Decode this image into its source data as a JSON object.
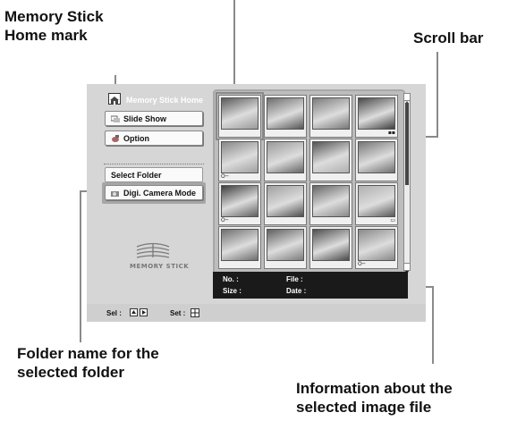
{
  "callouts": {
    "home_mark_line1": "Memory Stick",
    "home_mark_line2": "Home mark",
    "scroll_bar": "Scroll bar",
    "folder_name_line1": "Folder name for the",
    "folder_name_line2": "selected folder",
    "info_line1": "Information about the",
    "info_line2": "selected image file"
  },
  "sidebar": {
    "home_title": "Memory Stick Home",
    "slide_show": "Slide Show",
    "option": "Option",
    "select_folder": "Select Folder",
    "folder_name": "Digi. Camera Mode"
  },
  "logo": {
    "text": "MEMORY STICK"
  },
  "thumbnails": [
    {
      "subject": "puppy-portrait",
      "selected": true,
      "badge": ""
    },
    {
      "subject": "dog-closeup",
      "selected": false,
      "badge": ""
    },
    {
      "subject": "flowers",
      "selected": false,
      "badge": ""
    },
    {
      "subject": "cat-and-dog",
      "selected": false,
      "badge": "icons"
    },
    {
      "subject": "dog-on-bed",
      "selected": false,
      "badge": "key"
    },
    {
      "subject": "sky-landscape",
      "selected": false,
      "badge": ""
    },
    {
      "subject": "dog-at-bowl",
      "selected": false,
      "badge": ""
    },
    {
      "subject": "sitting-dog",
      "selected": false,
      "badge": ""
    },
    {
      "subject": "sunset-coast",
      "selected": false,
      "badge": "key"
    },
    {
      "subject": "clouds",
      "selected": false,
      "badge": ""
    },
    {
      "subject": "leaping-dog",
      "selected": false,
      "badge": ""
    },
    {
      "subject": "white-dog",
      "selected": false,
      "badge": "card"
    },
    {
      "subject": "sleeping-dog",
      "selected": false,
      "badge": ""
    },
    {
      "subject": "dogs-playing",
      "selected": false,
      "badge": ""
    },
    {
      "subject": "dog-face",
      "selected": false,
      "badge": ""
    },
    {
      "subject": "dog-portrait",
      "selected": false,
      "badge": "key"
    }
  ],
  "info_bar": {
    "no_label": "No. :",
    "file_label": "File :",
    "size_label": "Size :",
    "date_label": "Date :"
  },
  "status_bar": {
    "sel_label": "Sel :",
    "set_label": "Set :"
  },
  "colors": {
    "screen_bg": "#d6d6d6",
    "info_bar_bg": "#1a1a1a",
    "leader_line": "#888888"
  }
}
